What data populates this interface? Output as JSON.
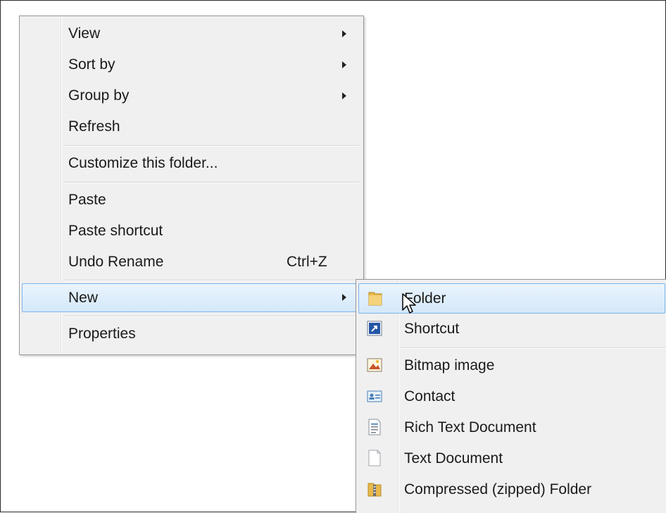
{
  "context_menu": {
    "items": [
      {
        "label": "View",
        "submenu": true
      },
      {
        "label": "Sort by",
        "submenu": true
      },
      {
        "label": "Group by",
        "submenu": true
      },
      {
        "label": "Refresh"
      },
      {
        "label": "Customize this folder..."
      },
      {
        "label": "Paste"
      },
      {
        "label": "Paste shortcut"
      },
      {
        "label": "Undo Rename",
        "shortcut": "Ctrl+Z"
      },
      {
        "label": "New",
        "submenu": true,
        "highlighted": true
      },
      {
        "label": "Properties"
      }
    ]
  },
  "new_submenu": {
    "items": [
      {
        "label": "Folder",
        "icon": "folder-icon",
        "highlighted": true
      },
      {
        "label": "Shortcut",
        "icon": "shortcut-icon"
      },
      {
        "label": "Bitmap image",
        "icon": "bitmap-icon"
      },
      {
        "label": "Contact",
        "icon": "contact-icon"
      },
      {
        "label": "Rich Text Document",
        "icon": "rich-text-document-icon"
      },
      {
        "label": "Text Document",
        "icon": "text-document-icon"
      },
      {
        "label": "Compressed (zipped) Folder",
        "icon": "zipped-folder-icon"
      }
    ]
  },
  "colors": {
    "menu_background": "#f0f0f0",
    "highlight_border": "#7eb4ea",
    "highlight_fill": "#dcecfc"
  }
}
